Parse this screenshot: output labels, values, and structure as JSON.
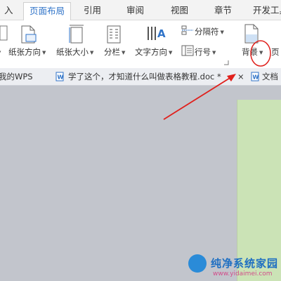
{
  "menu": {
    "tabs": [
      "入",
      "页面布局",
      "引用",
      "审阅",
      "视图",
      "章节",
      "开发工具"
    ],
    "active_tab": "页面布局"
  },
  "ribbon": {
    "paper_orientation": "纸张方向",
    "paper_size": "纸张大小",
    "columns": "分栏",
    "text_direction": "文字方向",
    "separator": "分隔符",
    "line_number": "行号",
    "background": "背景",
    "page_partial": "页"
  },
  "doc_tabs": {
    "my_wps": "我的WPS",
    "current_doc": "学了这个，才知道什么叫做表格教程.doc",
    "modified_mark": "*",
    "close": "×",
    "next_doc": "文档"
  },
  "watermark": {
    "title": "纯净系统家园",
    "url": "www.yidaimei.com"
  },
  "annotation": {
    "arrow_color": "#e0201c",
    "circle_color": "#e0201c"
  },
  "accent_color": "#2f73c8"
}
